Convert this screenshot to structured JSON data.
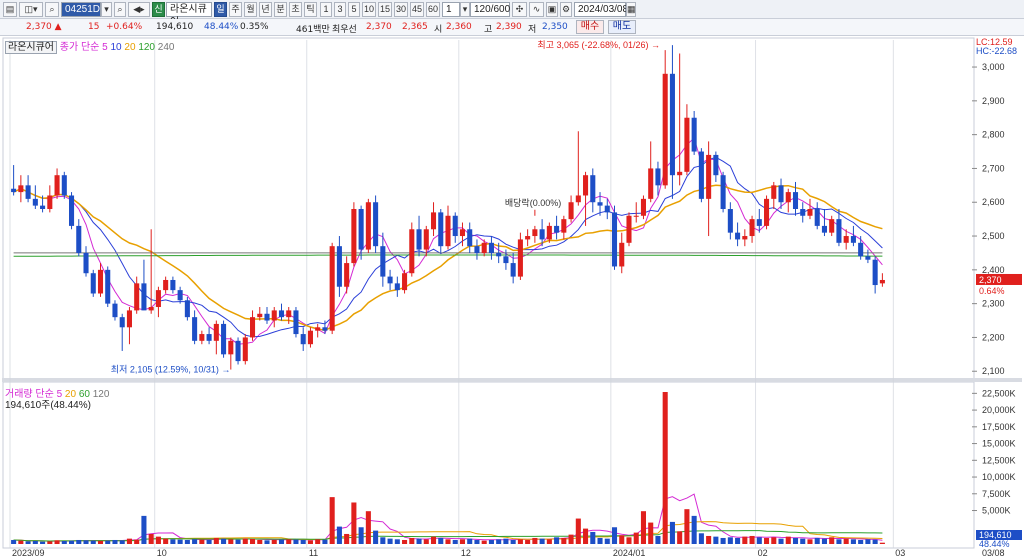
{
  "toolbar": {
    "stock_code": "04251D",
    "stock_name": "라온시큐어",
    "tag_sin": "신",
    "period_buttons": [
      "일",
      "주",
      "월",
      "년",
      "분",
      "초",
      "틱"
    ],
    "minute_buttons": [
      "1",
      "3",
      "5",
      "10",
      "15",
      "30",
      "45",
      "60"
    ],
    "unit_value": "1",
    "count_value": "120/600",
    "date_value": "2024/03/08"
  },
  "quote": {
    "price": "2,370",
    "change": "15",
    "change_pct": "+0.64%",
    "volume": "194,610",
    "vol_ratio": "48.44%",
    "turnover": "0.35%",
    "amount": "461백만",
    "best_label": "최우선",
    "best_ask": "2,370",
    "best_bid": "2,365",
    "open_label": "시",
    "open": "2,360",
    "high_label": "고",
    "high": "2,390",
    "low_label": "저",
    "low": "2,350",
    "buy_label": "매수",
    "sell_label": "매도"
  },
  "price_panel": {
    "title": "라온시큐어",
    "ma_label": "종가 단순",
    "ma_periods": [
      "5",
      "10",
      "20",
      "120",
      "240"
    ],
    "lc": "LC:12.59",
    "hc": "HC:-22.68",
    "high_note": "최고 3,065 (-22.68%, 01/26)",
    "low_note": "최저 2,105 (12.59%, 10/31)",
    "dividend_note": "배당락(0.00%)",
    "current_price_tag": "2,370",
    "current_pct_tag": "0.64%",
    "y_ticks": [
      "3,000",
      "2,900",
      "2,800",
      "2,700",
      "2,600",
      "2,500",
      "2,400",
      "2,300",
      "2,200",
      "2,100"
    ]
  },
  "volume_panel": {
    "title": "거래량 단순",
    "ma_periods": [
      "5",
      "20",
      "60",
      "120"
    ],
    "current_value": "194,610주(48.44%)",
    "y_ticks": [
      "22,500K",
      "20,000K",
      "17,500K",
      "15,000K",
      "12,500K",
      "10,000K",
      "7,500K",
      "5,000K"
    ],
    "current_tag": "194,610",
    "current_pct_tag": "48.44%"
  },
  "x_ticks": [
    "2023/09",
    "10",
    "11",
    "12",
    "2024/01",
    "02",
    "03",
    "03/08"
  ],
  "colors": {
    "up": "#e0201d",
    "down": "#1d4ec6",
    "ma5": "#d42ad4",
    "ma10": "#2b3fd8",
    "ma20": "#e8a000",
    "ma120": "#2ca02c",
    "ma240": "#777777"
  },
  "chart_data": {
    "type": "candlestick",
    "y_range": [
      2080,
      3080
    ],
    "volume_range": [
      0,
      23000
    ],
    "candles": [
      {
        "o": 2640,
        "h": 2710,
        "l": 2620,
        "c": 2630
      },
      {
        "o": 2630,
        "h": 2680,
        "l": 2600,
        "c": 2650
      },
      {
        "o": 2650,
        "h": 2680,
        "l": 2600,
        "c": 2610
      },
      {
        "o": 2610,
        "h": 2650,
        "l": 2580,
        "c": 2590
      },
      {
        "o": 2590,
        "h": 2620,
        "l": 2570,
        "c": 2580
      },
      {
        "o": 2580,
        "h": 2650,
        "l": 2570,
        "c": 2620
      },
      {
        "o": 2620,
        "h": 2700,
        "l": 2610,
        "c": 2680
      },
      {
        "o": 2680,
        "h": 2690,
        "l": 2610,
        "c": 2620
      },
      {
        "o": 2620,
        "h": 2630,
        "l": 2520,
        "c": 2530
      },
      {
        "o": 2530,
        "h": 2550,
        "l": 2440,
        "c": 2450
      },
      {
        "o": 2450,
        "h": 2470,
        "l": 2380,
        "c": 2390
      },
      {
        "o": 2390,
        "h": 2400,
        "l": 2320,
        "c": 2330
      },
      {
        "o": 2330,
        "h": 2420,
        "l": 2320,
        "c": 2400
      },
      {
        "o": 2400,
        "h": 2410,
        "l": 2290,
        "c": 2300
      },
      {
        "o": 2300,
        "h": 2310,
        "l": 2250,
        "c": 2260
      },
      {
        "o": 2260,
        "h": 2270,
        "l": 2160,
        "c": 2230
      },
      {
        "o": 2230,
        "h": 2290,
        "l": 2180,
        "c": 2280
      },
      {
        "o": 2280,
        "h": 2380,
        "l": 2270,
        "c": 2360
      },
      {
        "o": 2360,
        "h": 2430,
        "l": 2340,
        "c": 2280
      },
      {
        "o": 2280,
        "h": 2520,
        "l": 2270,
        "c": 2290
      },
      {
        "o": 2290,
        "h": 2350,
        "l": 2260,
        "c": 2340
      },
      {
        "o": 2340,
        "h": 2380,
        "l": 2330,
        "c": 2370
      },
      {
        "o": 2370,
        "h": 2380,
        "l": 2330,
        "c": 2340
      },
      {
        "o": 2340,
        "h": 2350,
        "l": 2300,
        "c": 2310
      },
      {
        "o": 2310,
        "h": 2320,
        "l": 2250,
        "c": 2260
      },
      {
        "o": 2260,
        "h": 2280,
        "l": 2180,
        "c": 2190
      },
      {
        "o": 2190,
        "h": 2220,
        "l": 2180,
        "c": 2210
      },
      {
        "o": 2210,
        "h": 2230,
        "l": 2180,
        "c": 2190
      },
      {
        "o": 2190,
        "h": 2250,
        "l": 2150,
        "c": 2240
      },
      {
        "o": 2240,
        "h": 2250,
        "l": 2140,
        "c": 2150
      },
      {
        "o": 2150,
        "h": 2200,
        "l": 2105,
        "c": 2190
      },
      {
        "o": 2190,
        "h": 2200,
        "l": 2120,
        "c": 2130
      },
      {
        "o": 2130,
        "h": 2210,
        "l": 2120,
        "c": 2200
      },
      {
        "o": 2200,
        "h": 2280,
        "l": 2190,
        "c": 2260
      },
      {
        "o": 2260,
        "h": 2290,
        "l": 2250,
        "c": 2270
      },
      {
        "o": 2270,
        "h": 2290,
        "l": 2240,
        "c": 2250
      },
      {
        "o": 2250,
        "h": 2290,
        "l": 2230,
        "c": 2280
      },
      {
        "o": 2280,
        "h": 2300,
        "l": 2250,
        "c": 2260
      },
      {
        "o": 2260,
        "h": 2290,
        "l": 2240,
        "c": 2280
      },
      {
        "o": 2280,
        "h": 2290,
        "l": 2200,
        "c": 2210
      },
      {
        "o": 2210,
        "h": 2230,
        "l": 2160,
        "c": 2180
      },
      {
        "o": 2180,
        "h": 2230,
        "l": 2170,
        "c": 2220
      },
      {
        "o": 2220,
        "h": 2240,
        "l": 2200,
        "c": 2230
      },
      {
        "o": 2230,
        "h": 2250,
        "l": 2210,
        "c": 2220
      },
      {
        "o": 2220,
        "h": 2480,
        "l": 2210,
        "c": 2470
      },
      {
        "o": 2470,
        "h": 2500,
        "l": 2320,
        "c": 2350
      },
      {
        "o": 2350,
        "h": 2440,
        "l": 2330,
        "c": 2420
      },
      {
        "o": 2420,
        "h": 2600,
        "l": 2410,
        "c": 2580
      },
      {
        "o": 2580,
        "h": 2590,
        "l": 2430,
        "c": 2460
      },
      {
        "o": 2460,
        "h": 2610,
        "l": 2450,
        "c": 2600
      },
      {
        "o": 2600,
        "h": 2620,
        "l": 2450,
        "c": 2470
      },
      {
        "o": 2470,
        "h": 2510,
        "l": 2350,
        "c": 2380
      },
      {
        "o": 2380,
        "h": 2400,
        "l": 2340,
        "c": 2360
      },
      {
        "o": 2360,
        "h": 2380,
        "l": 2320,
        "c": 2340
      },
      {
        "o": 2340,
        "h": 2400,
        "l": 2330,
        "c": 2390
      },
      {
        "o": 2390,
        "h": 2540,
        "l": 2380,
        "c": 2520
      },
      {
        "o": 2520,
        "h": 2560,
        "l": 2440,
        "c": 2460
      },
      {
        "o": 2460,
        "h": 2530,
        "l": 2440,
        "c": 2520
      },
      {
        "o": 2520,
        "h": 2600,
        "l": 2500,
        "c": 2570
      },
      {
        "o": 2570,
        "h": 2580,
        "l": 2450,
        "c": 2470
      },
      {
        "o": 2470,
        "h": 2590,
        "l": 2460,
        "c": 2560
      },
      {
        "o": 2560,
        "h": 2570,
        "l": 2480,
        "c": 2500
      },
      {
        "o": 2500,
        "h": 2540,
        "l": 2470,
        "c": 2520
      },
      {
        "o": 2520,
        "h": 2540,
        "l": 2450,
        "c": 2470
      },
      {
        "o": 2470,
        "h": 2490,
        "l": 2430,
        "c": 2450
      },
      {
        "o": 2450,
        "h": 2490,
        "l": 2440,
        "c": 2480
      },
      {
        "o": 2480,
        "h": 2500,
        "l": 2430,
        "c": 2450
      },
      {
        "o": 2450,
        "h": 2480,
        "l": 2420,
        "c": 2440
      },
      {
        "o": 2440,
        "h": 2460,
        "l": 2400,
        "c": 2420
      },
      {
        "o": 2420,
        "h": 2450,
        "l": 2360,
        "c": 2380
      },
      {
        "o": 2380,
        "h": 2510,
        "l": 2370,
        "c": 2490
      },
      {
        "o": 2490,
        "h": 2520,
        "l": 2470,
        "c": 2500
      },
      {
        "o": 2500,
        "h": 2530,
        "l": 2480,
        "c": 2520
      },
      {
        "o": 2520,
        "h": 2550,
        "l": 2470,
        "c": 2490
      },
      {
        "o": 2490,
        "h": 2540,
        "l": 2480,
        "c": 2530
      },
      {
        "o": 2530,
        "h": 2560,
        "l": 2490,
        "c": 2510
      },
      {
        "o": 2510,
        "h": 2560,
        "l": 2490,
        "c": 2550
      },
      {
        "o": 2550,
        "h": 2620,
        "l": 2540,
        "c": 2600
      },
      {
        "o": 2600,
        "h": 2810,
        "l": 2590,
        "c": 2620
      },
      {
        "o": 2620,
        "h": 2690,
        "l": 2530,
        "c": 2680
      },
      {
        "o": 2680,
        "h": 2700,
        "l": 2570,
        "c": 2600
      },
      {
        "o": 2600,
        "h": 2630,
        "l": 2560,
        "c": 2590
      },
      {
        "o": 2590,
        "h": 2610,
        "l": 2550,
        "c": 2570
      },
      {
        "o": 2570,
        "h": 2590,
        "l": 2400,
        "c": 2410
      },
      {
        "o": 2410,
        "h": 2510,
        "l": 2390,
        "c": 2480
      },
      {
        "o": 2480,
        "h": 2570,
        "l": 2470,
        "c": 2560
      },
      {
        "o": 2560,
        "h": 2600,
        "l": 2540,
        "c": 2560
      },
      {
        "o": 2560,
        "h": 2620,
        "l": 2550,
        "c": 2610
      },
      {
        "o": 2610,
        "h": 2780,
        "l": 2600,
        "c": 2700
      },
      {
        "o": 2700,
        "h": 2720,
        "l": 2620,
        "c": 2650
      },
      {
        "o": 2650,
        "h": 3050,
        "l": 2640,
        "c": 2980
      },
      {
        "o": 2980,
        "h": 3065,
        "l": 2610,
        "c": 2680
      },
      {
        "o": 2680,
        "h": 3040,
        "l": 2650,
        "c": 2690
      },
      {
        "o": 2690,
        "h": 2890,
        "l": 2680,
        "c": 2850
      },
      {
        "o": 2850,
        "h": 2870,
        "l": 2740,
        "c": 2750
      },
      {
        "o": 2750,
        "h": 2760,
        "l": 2600,
        "c": 2610
      },
      {
        "o": 2610,
        "h": 2780,
        "l": 2500,
        "c": 2740
      },
      {
        "o": 2740,
        "h": 2750,
        "l": 2660,
        "c": 2680
      },
      {
        "o": 2680,
        "h": 2690,
        "l": 2570,
        "c": 2580
      },
      {
        "o": 2580,
        "h": 2600,
        "l": 2490,
        "c": 2510
      },
      {
        "o": 2510,
        "h": 2540,
        "l": 2470,
        "c": 2490
      },
      {
        "o": 2490,
        "h": 2520,
        "l": 2470,
        "c": 2500
      },
      {
        "o": 2500,
        "h": 2560,
        "l": 2480,
        "c": 2550
      },
      {
        "o": 2550,
        "h": 2580,
        "l": 2510,
        "c": 2530
      },
      {
        "o": 2530,
        "h": 2620,
        "l": 2520,
        "c": 2610
      },
      {
        "o": 2610,
        "h": 2660,
        "l": 2580,
        "c": 2650
      },
      {
        "o": 2650,
        "h": 2670,
        "l": 2580,
        "c": 2600
      },
      {
        "o": 2600,
        "h": 2640,
        "l": 2570,
        "c": 2630
      },
      {
        "o": 2630,
        "h": 2660,
        "l": 2560,
        "c": 2580
      },
      {
        "o": 2580,
        "h": 2600,
        "l": 2540,
        "c": 2560
      },
      {
        "o": 2560,
        "h": 2610,
        "l": 2550,
        "c": 2580
      },
      {
        "o": 2580,
        "h": 2600,
        "l": 2520,
        "c": 2530
      },
      {
        "o": 2530,
        "h": 2580,
        "l": 2500,
        "c": 2510
      },
      {
        "o": 2510,
        "h": 2560,
        "l": 2500,
        "c": 2550
      },
      {
        "o": 2550,
        "h": 2580,
        "l": 2470,
        "c": 2480
      },
      {
        "o": 2480,
        "h": 2520,
        "l": 2460,
        "c": 2500
      },
      {
        "o": 2500,
        "h": 2530,
        "l": 2470,
        "c": 2480
      },
      {
        "o": 2480,
        "h": 2500,
        "l": 2430,
        "c": 2440
      },
      {
        "o": 2440,
        "h": 2460,
        "l": 2420,
        "c": 2430
      },
      {
        "o": 2430,
        "h": 2440,
        "l": 2330,
        "c": 2355
      },
      {
        "o": 2360,
        "h": 2390,
        "l": 2350,
        "c": 2370
      }
    ],
    "volumes": [
      600,
      500,
      400,
      450,
      350,
      400,
      550,
      450,
      500,
      600,
      550,
      500,
      450,
      500,
      600,
      550,
      800,
      650,
      4200,
      1500,
      1100,
      800,
      700,
      650,
      600,
      700,
      650,
      600,
      900,
      800,
      700,
      650,
      800,
      750,
      600,
      550,
      600,
      650,
      700,
      650,
      600,
      550,
      700,
      650,
      7000,
      2600,
      1500,
      6200,
      2500,
      4900,
      2000,
      1000,
      800,
      700,
      600,
      900,
      800,
      700,
      1100,
      900,
      700,
      600,
      700,
      800,
      600,
      500,
      600,
      700,
      800,
      600,
      700,
      600,
      900,
      800,
      700,
      1000,
      900,
      1400,
      3800,
      2300,
      1800,
      900,
      800,
      2500,
      1300,
      1000,
      1700,
      4900,
      3200,
      1200,
      22700,
      3300,
      1900,
      5200,
      4200,
      1600,
      1200,
      1100,
      900,
      1000,
      900,
      1100,
      1200,
      1000,
      900,
      1000,
      800,
      1100,
      900,
      800,
      700,
      900,
      800,
      1000,
      700,
      800,
      700,
      600,
      700,
      650,
      194.61
    ]
  }
}
